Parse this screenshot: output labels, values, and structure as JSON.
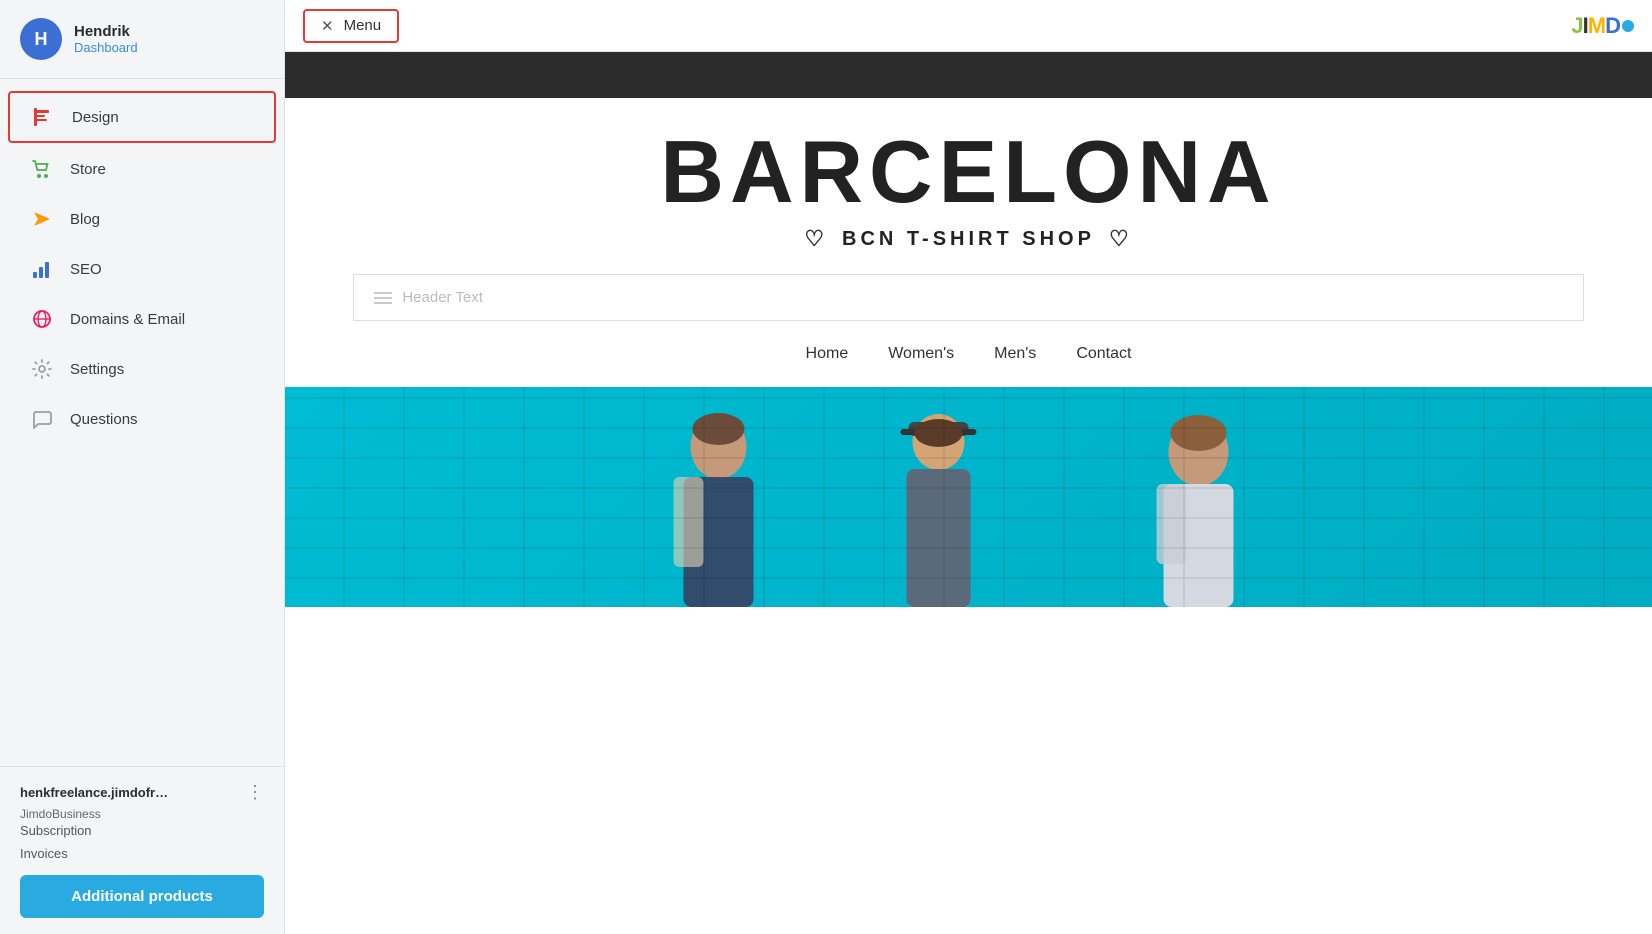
{
  "sidebar": {
    "user": {
      "avatar_letter": "H",
      "name": "Hendrik",
      "dashboard_label": "Dashboard"
    },
    "nav_items": [
      {
        "id": "design",
        "label": "Design",
        "active": true
      },
      {
        "id": "store",
        "label": "Store",
        "active": false
      },
      {
        "id": "blog",
        "label": "Blog",
        "active": false
      },
      {
        "id": "seo",
        "label": "SEO",
        "active": false
      },
      {
        "id": "domains-email",
        "label": "Domains & Email",
        "active": false
      },
      {
        "id": "settings",
        "label": "Settings",
        "active": false
      },
      {
        "id": "questions",
        "label": "Questions",
        "active": false
      }
    ],
    "footer": {
      "site_name": "henkfreelance.jimdofr…",
      "site_plan": "JimdoBusiness",
      "subscription_label": "Subscription",
      "invoices_label": "Invoices",
      "additional_products_label": "Additional products"
    }
  },
  "topbar": {
    "menu_label": "Menu",
    "logo_text": "JIMDO"
  },
  "preview": {
    "dark_bar_visible": true,
    "title": "BARCELONA",
    "subtitle": "BCN T-SHIRT SHOP",
    "header_text_placeholder": "Header Text",
    "nav_items": [
      {
        "label": "Home"
      },
      {
        "label": "Women's"
      },
      {
        "label": "Men's"
      },
      {
        "label": "Contact"
      }
    ]
  }
}
